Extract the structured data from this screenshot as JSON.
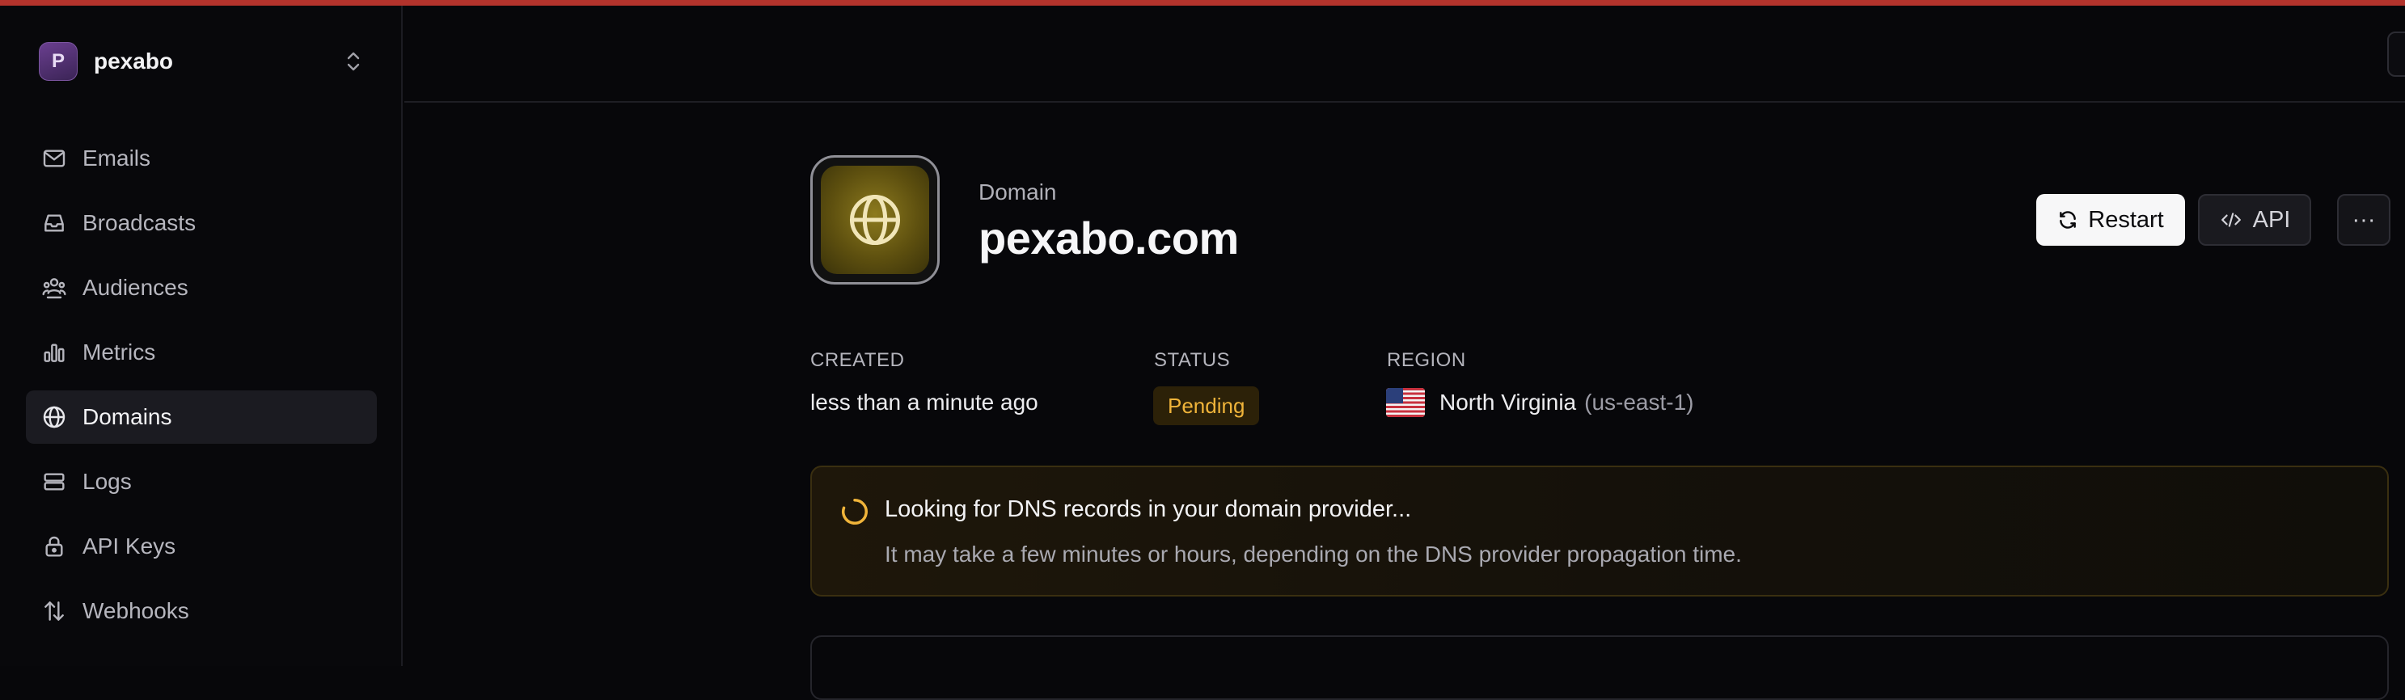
{
  "workspace": {
    "initial": "P",
    "name": "pexabo"
  },
  "sidebar": {
    "items": [
      {
        "label": "Emails",
        "icon": "mail-icon"
      },
      {
        "label": "Broadcasts",
        "icon": "inbox-icon"
      },
      {
        "label": "Audiences",
        "icon": "users-icon"
      },
      {
        "label": "Metrics",
        "icon": "bar-chart-icon"
      },
      {
        "label": "Domains",
        "icon": "globe-icon",
        "active": true
      },
      {
        "label": "Logs",
        "icon": "list-icon"
      },
      {
        "label": "API Keys",
        "icon": "lock-icon"
      },
      {
        "label": "Webhooks",
        "icon": "arrows-icon"
      }
    ]
  },
  "domain": {
    "kicker": "Domain",
    "name": "pexabo.com"
  },
  "actions": {
    "restart": "Restart",
    "api": "API",
    "more": "···"
  },
  "meta": {
    "created_label": "CREATED",
    "created_value": "less than a minute ago",
    "status_label": "STATUS",
    "status_value": "Pending",
    "region_label": "REGION",
    "region_name": "North Virginia",
    "region_code": "(us-east-1)"
  },
  "notice": {
    "title": "Looking for DNS records in your domain provider...",
    "description": "It may take a few minutes or hours, depending on the DNS provider propagation time."
  },
  "colors": {
    "accent_top": "#b3332c",
    "pending": "#f0b43a",
    "active_nav": "#1b1b21"
  }
}
